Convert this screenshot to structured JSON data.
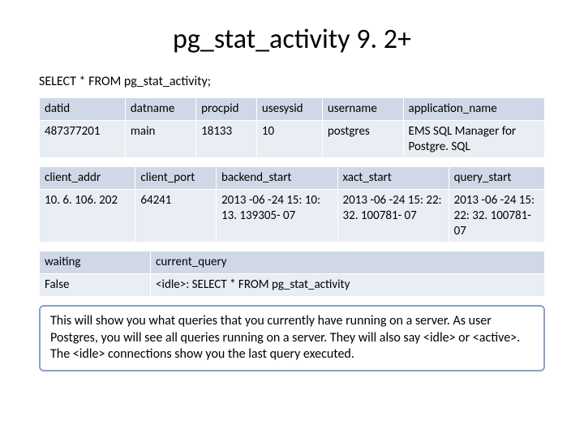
{
  "title": "pg_stat_activity 9. 2+",
  "sql": "SELECT * FROM pg_stat_activity;",
  "t1": {
    "headers": [
      "datid",
      "datname",
      "procpid",
      "usesysid",
      "username",
      "application_name"
    ],
    "row": [
      "487377201",
      "main",
      "18133",
      "10",
      "postgres",
      "EMS SQL Manager for Postgre. SQL"
    ]
  },
  "t2": {
    "headers": [
      "client_addr",
      "client_port",
      "backend_start",
      "xact_start",
      "query_start"
    ],
    "row": [
      "10. 6. 106. 202",
      "64241",
      "2013 -06 -24 15: 10: 13. 139305- 07",
      "2013 -06 -24 15: 22: 32. 100781- 07",
      "2013 -06 -24 15: 22: 32. 100781- 07"
    ]
  },
  "t3": {
    "headers": [
      "waiting",
      "current_query"
    ],
    "row": [
      "False",
      "<idle>: SELECT * FROM pg_stat_activity"
    ]
  },
  "note": "This will show you what queries that you currently have running on a server. As user Postgres, you will see all queries running on a server. They will also say <idle> or <active>. The <idle> connections show you the last query executed."
}
